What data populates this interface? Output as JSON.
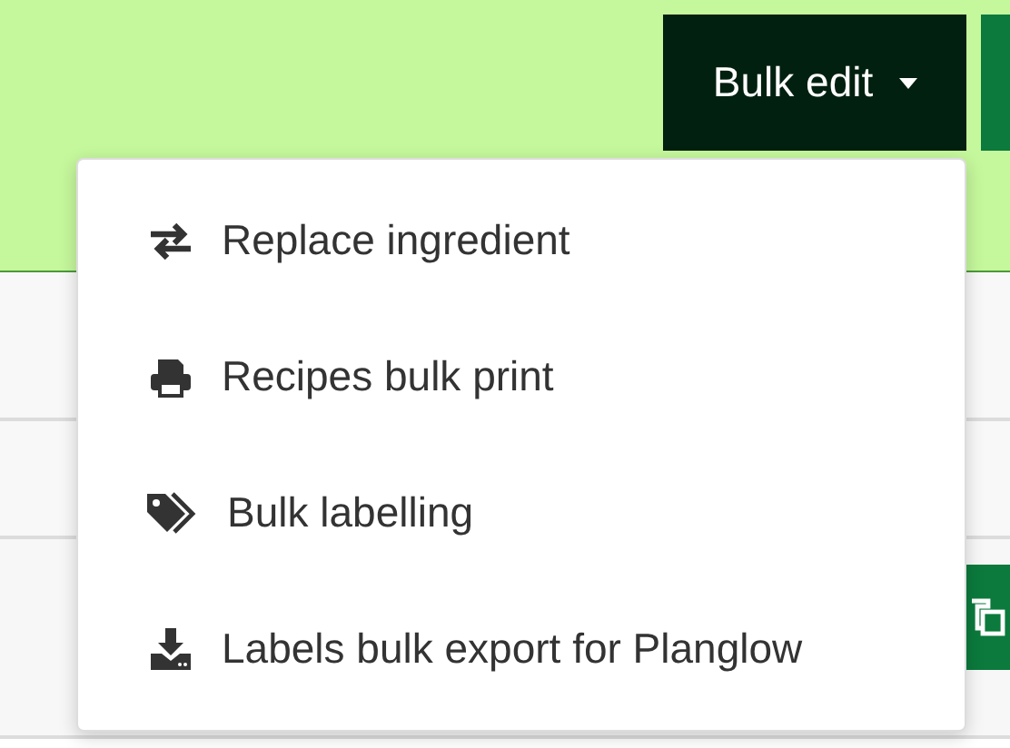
{
  "toolbar": {
    "bulk_edit": {
      "label": "Bulk edit",
      "expanded": true
    }
  },
  "bulk_edit_menu": {
    "items": [
      {
        "kind": "swap",
        "label": "Replace ingredient"
      },
      {
        "kind": "print",
        "label": "Recipes bulk print"
      },
      {
        "kind": "tags",
        "label": "Bulk labelling"
      },
      {
        "kind": "download",
        "label": "Labels bulk export for Planglow"
      }
    ]
  }
}
